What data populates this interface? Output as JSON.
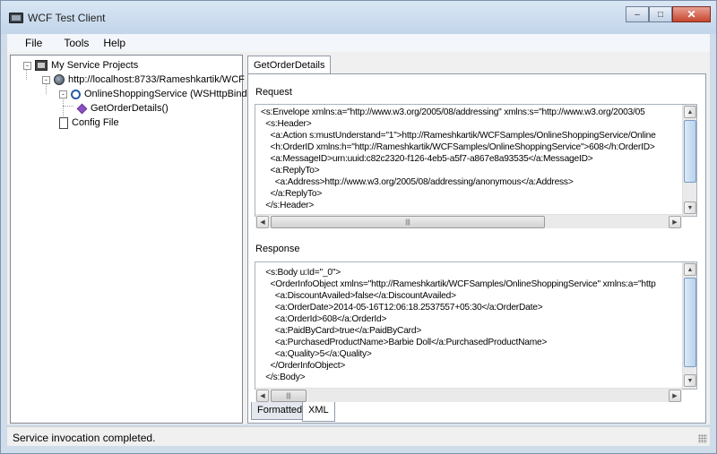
{
  "window": {
    "title": "WCF Test Client",
    "controls": {
      "minimize": "–",
      "maximize": "□",
      "close": "✕"
    }
  },
  "menu": {
    "items": [
      "File",
      "Tools",
      "Help"
    ]
  },
  "tree": {
    "root": "My Service Projects",
    "endpoint": "http://localhost:8733/Rameshkartik/WCF",
    "service": "OnlineShoppingService (WSHttpBindi",
    "operation": "GetOrderDetails()",
    "config": "Config File",
    "expander_minus": "-"
  },
  "tab": {
    "label": "GetOrderDetails"
  },
  "request": {
    "label": "Request",
    "lines": [
      "<s:Envelope xmlns:a=\"http://www.w3.org/2005/08/addressing\" xmlns:s=\"http://www.w3.org/2003/05",
      "  <s:Header>",
      "    <a:Action s:mustUnderstand=\"1\">http://Rameshkartik/WCFSamples/OnlineShoppingService/Online",
      "    <h:OrderID xmlns:h=\"http://Rameshkartik/WCFSamples/OnlineShoppingService\">608</h:OrderID>",
      "    <a:MessageID>urn:uuid:c82c2320-f126-4eb5-a5f7-a867e8a93535</a:MessageID>",
      "    <a:ReplyTo>",
      "      <a:Address>http://www.w3.org/2005/08/addressing/anonymous</a:Address>",
      "    </a:ReplyTo>",
      "  </s:Header>"
    ]
  },
  "response": {
    "label": "Response",
    "lines": [
      "  <s:Body u:Id=\"_0\">",
      "    <OrderInfoObject xmlns=\"http://Rameshkartik/WCFSamples/OnlineShoppingService\" xmlns:a=\"http",
      "      <a:DiscountAvailed>false</a:DiscountAvailed>",
      "      <a:OrderDate>2014-05-16T12:06:18.2537557+05:30</a:OrderDate>",
      "      <a:OrderId>608</a:OrderId>",
      "      <a:PaidByCard>true</a:PaidByCard>",
      "      <a:PurchasedProductName>Barbie Doll</a:PurchasedProductName>",
      "      <a:Quality>5</a:Quality>",
      "    </OrderInfoObject>",
      "  </s:Body>"
    ]
  },
  "bottom_tabs": {
    "formatted": "Formatted",
    "xml": "XML"
  },
  "status": {
    "text": "Service invocation completed."
  }
}
